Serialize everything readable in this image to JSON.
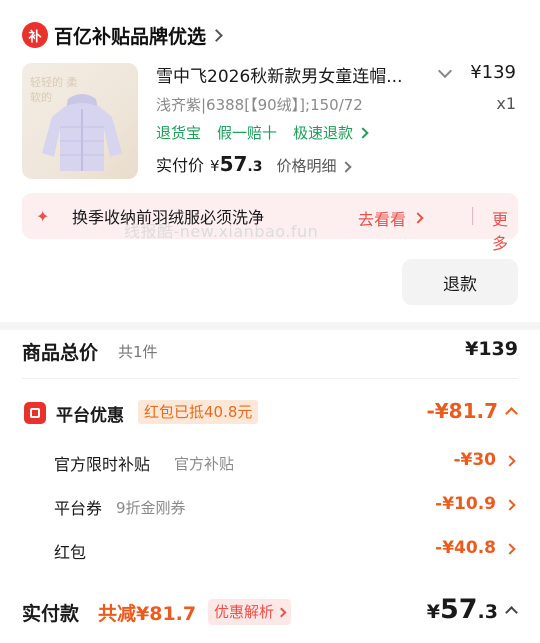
{
  "store": {
    "logo_char": "补",
    "name": "百亿补贴品牌优选",
    "icon": "chevron-right-icon"
  },
  "product": {
    "thumb_caption": "轻轻的 柔软的",
    "title": "雪中飞2026秋新款男女童连帽...",
    "unit_price": "¥139",
    "sku": "浅齐紫|6388[【90绒】];150/72",
    "quantity": "x1",
    "services": [
      "退货宝",
      "假一赔十",
      "极速退款"
    ],
    "paid_label": "实付价",
    "paid_currency": "¥",
    "paid_int": "57",
    "paid_dec": ".3",
    "price_detail": "价格明细"
  },
  "promo": {
    "icon": "sparkle-icon",
    "text": "换季收纳前羽绒服必须洗净",
    "go_label": "去看看",
    "more_label": "更多"
  },
  "watermark": "线报酷-new.xianbao.fun",
  "refund_button": "退款",
  "summary": {
    "total_label": "商品总价",
    "total_count": "共1件",
    "total_price": "¥139",
    "platform": {
      "icon": "coupon-icon",
      "label": "平台优惠",
      "tag": "红包已抵40.8元",
      "amount": "-¥81.7"
    },
    "items": [
      {
        "label": "官方限时补贴",
        "note": "官方补贴",
        "amount": "-¥30"
      },
      {
        "label": "平台券",
        "note": "9折金刚券",
        "amount": "-¥10.9"
      },
      {
        "label": "红包",
        "note": "",
        "amount": "-¥40.8"
      }
    ],
    "final_label": "实付款",
    "final_saved": "共减¥81.7",
    "final_tag": "优惠解析",
    "final_currency": "¥",
    "final_int": "57",
    "final_dec": ".3"
  },
  "colors": {
    "accent_red": "#e8322b",
    "discount_orange": "#ec5b1e",
    "service_green": "#1f9e5a"
  }
}
